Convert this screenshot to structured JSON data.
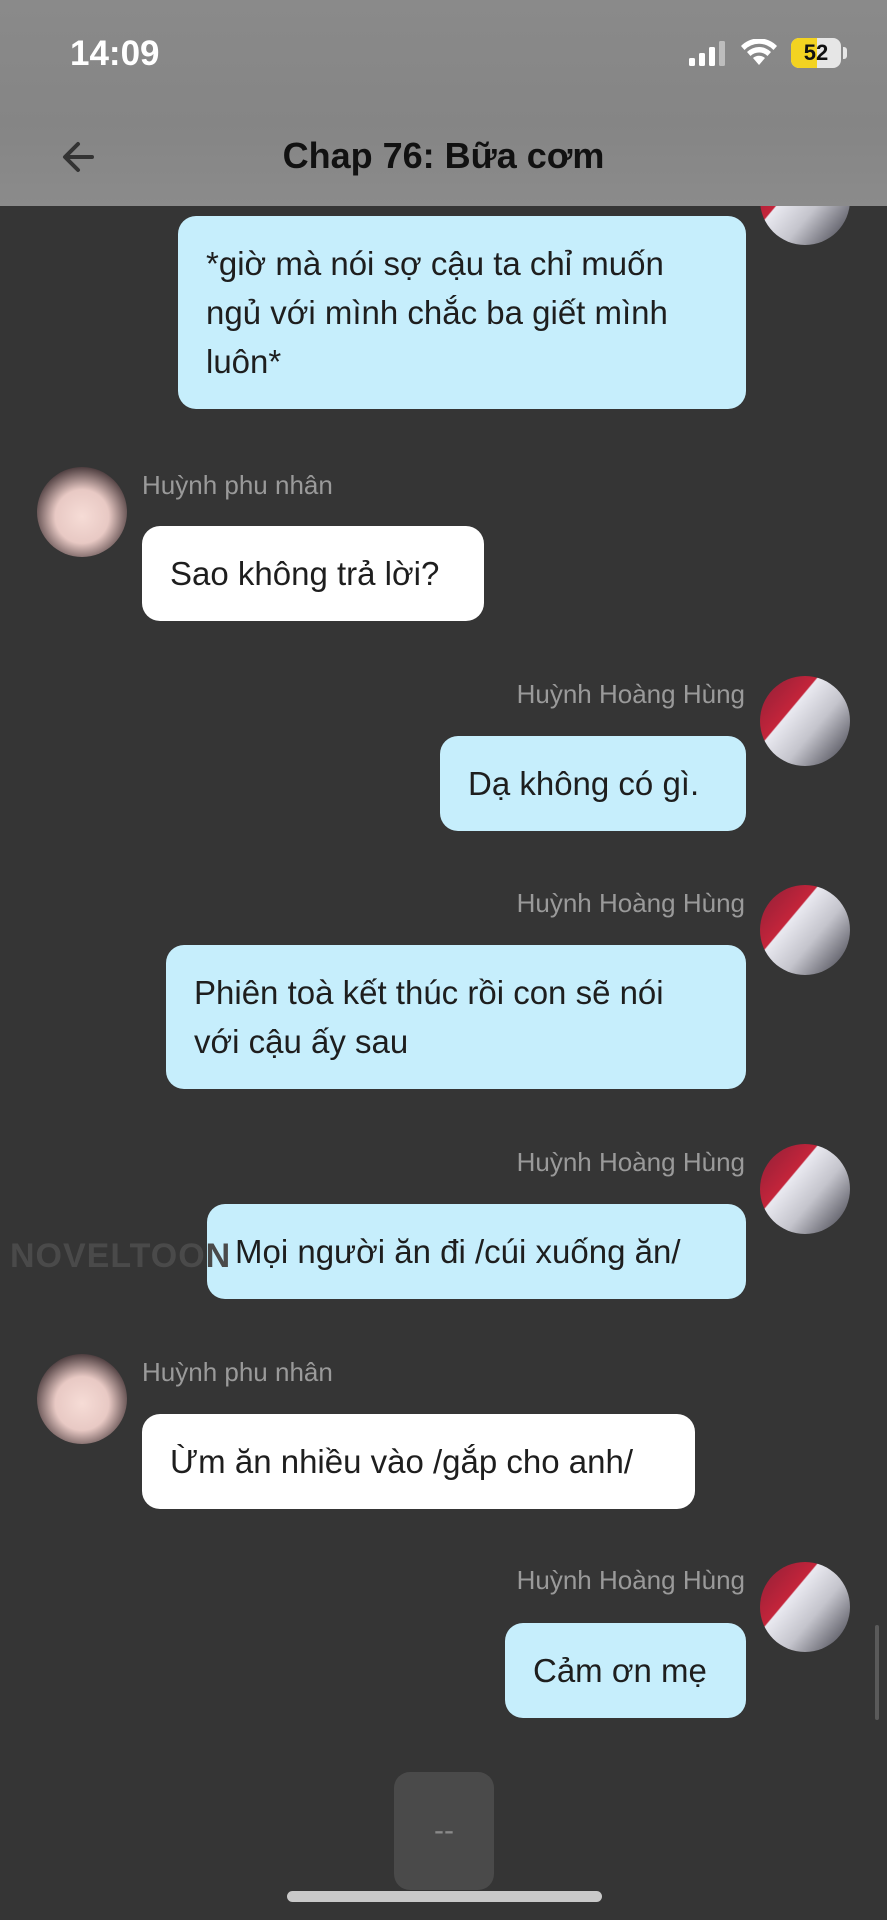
{
  "status_bar": {
    "time": "14:09",
    "battery": "52",
    "battery_level_percent": 52
  },
  "header": {
    "title": "Chap 76: Bữa cơm"
  },
  "messages": [
    {
      "sender": "",
      "side": "right",
      "text": "*giờ mà nói sợ cậu ta chỉ muốn ngủ với mình chắc ba giết mình luôn*"
    },
    {
      "sender": "Huỳnh phu nhân",
      "side": "left",
      "text": "Sao không trả lời?"
    },
    {
      "sender": "Huỳnh Hoàng Hùng",
      "side": "right",
      "text": "Dạ không có gì."
    },
    {
      "sender": "Huỳnh Hoàng Hùng",
      "side": "right",
      "text": "Phiên toà kết thúc rồi con sẽ nói với cậu ấy sau"
    },
    {
      "sender": "Huỳnh Hoàng Hùng",
      "side": "right",
      "text": "Mọi người ăn đi /cúi xuống ăn/"
    },
    {
      "sender": "Huỳnh phu nhân",
      "side": "left",
      "text": "Ừm ăn nhiều vào /gắp cho anh/"
    },
    {
      "sender": "Huỳnh Hoàng Hùng",
      "side": "right",
      "text": "Cảm ơn mẹ"
    }
  ],
  "watermark": "NOVELTOON",
  "bottom_button": "--",
  "colors": {
    "background": "#353535",
    "bubble_right": "#c6eefc",
    "bubble_left": "#ffffff",
    "battery": "#f3d321"
  }
}
